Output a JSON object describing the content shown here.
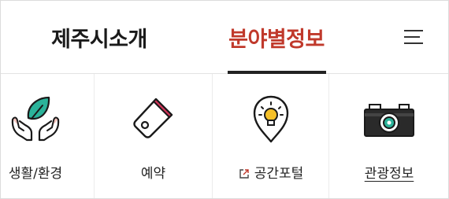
{
  "header": {
    "tabs": [
      {
        "label": "제주시소개",
        "active": false
      },
      {
        "label": "분야별정보",
        "active": true
      }
    ],
    "active_color": "#c0392b",
    "menu_icon": "hamburger-menu-icon"
  },
  "categories": [
    {
      "label": "생활/환경",
      "icon": "leaf-hands-icon"
    },
    {
      "label": "예약",
      "icon": "tag-icon"
    },
    {
      "label": "공간포털",
      "icon": "lightbulb-pin-icon",
      "external": true
    },
    {
      "label": "관광정보",
      "icon": "camera-icon",
      "underlined": true
    }
  ]
}
